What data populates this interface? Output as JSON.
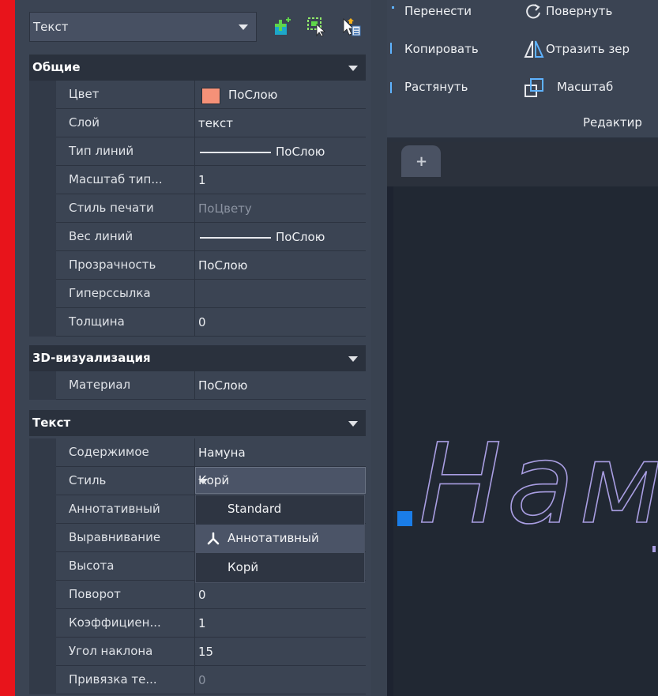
{
  "selector": {
    "value": "Текст"
  },
  "sections": {
    "general": {
      "title": "Общие",
      "rows": [
        {
          "label": "Цвет",
          "value": "ПоСлою",
          "swatch": "#f59178"
        },
        {
          "label": "Слой",
          "value": "текст"
        },
        {
          "label": "Тип линий",
          "value": "ПоСлою"
        },
        {
          "label": "Масштаб тип...",
          "value": "1"
        },
        {
          "label": "Стиль печати",
          "value": "ПоЦвету"
        },
        {
          "label": "Вес линий",
          "value": "ПоСлою"
        },
        {
          "label": "Прозрачность",
          "value": "ПоСлою"
        },
        {
          "label": "Гиперссылка",
          "value": ""
        },
        {
          "label": "Толщина",
          "value": "0"
        }
      ]
    },
    "viz3d": {
      "title": "3D-визуализация",
      "rows": [
        {
          "label": "Материал",
          "value": "ПоСлою"
        }
      ]
    },
    "text": {
      "title": "Текст",
      "rows": [
        {
          "label": "Содержимое",
          "value": "Намуна"
        },
        {
          "label": "Стиль",
          "value": "Корй"
        },
        {
          "label": "Аннотативный",
          "value": ""
        },
        {
          "label": "Выравнивание",
          "value": ""
        },
        {
          "label": "Высота",
          "value": ""
        },
        {
          "label": "Поворот",
          "value": "0"
        },
        {
          "label": "Коэффициен...",
          "value": "1"
        },
        {
          "label": "Угол наклона",
          "value": "15"
        },
        {
          "label": "Привязка те...",
          "value": "0"
        }
      ]
    }
  },
  "style_dropdown": {
    "options": [
      "Standard",
      "Аннотативный",
      "Корй"
    ],
    "selected": "Аннотативный"
  },
  "ribbon": {
    "move": "Перенести",
    "rotate": "Повернуть",
    "copy": "Копировать",
    "mirror": "Отразить зер",
    "stretch": "Растянуть",
    "scale": "Масштаб",
    "group": "Редактир"
  },
  "tabs": {
    "new_tab": "+"
  },
  "canvas": {
    "text": "Нам",
    "text_color": "#a99ee2"
  },
  "colors": {
    "grip": "#1a7de8",
    "accent_red": "#e8141b"
  }
}
